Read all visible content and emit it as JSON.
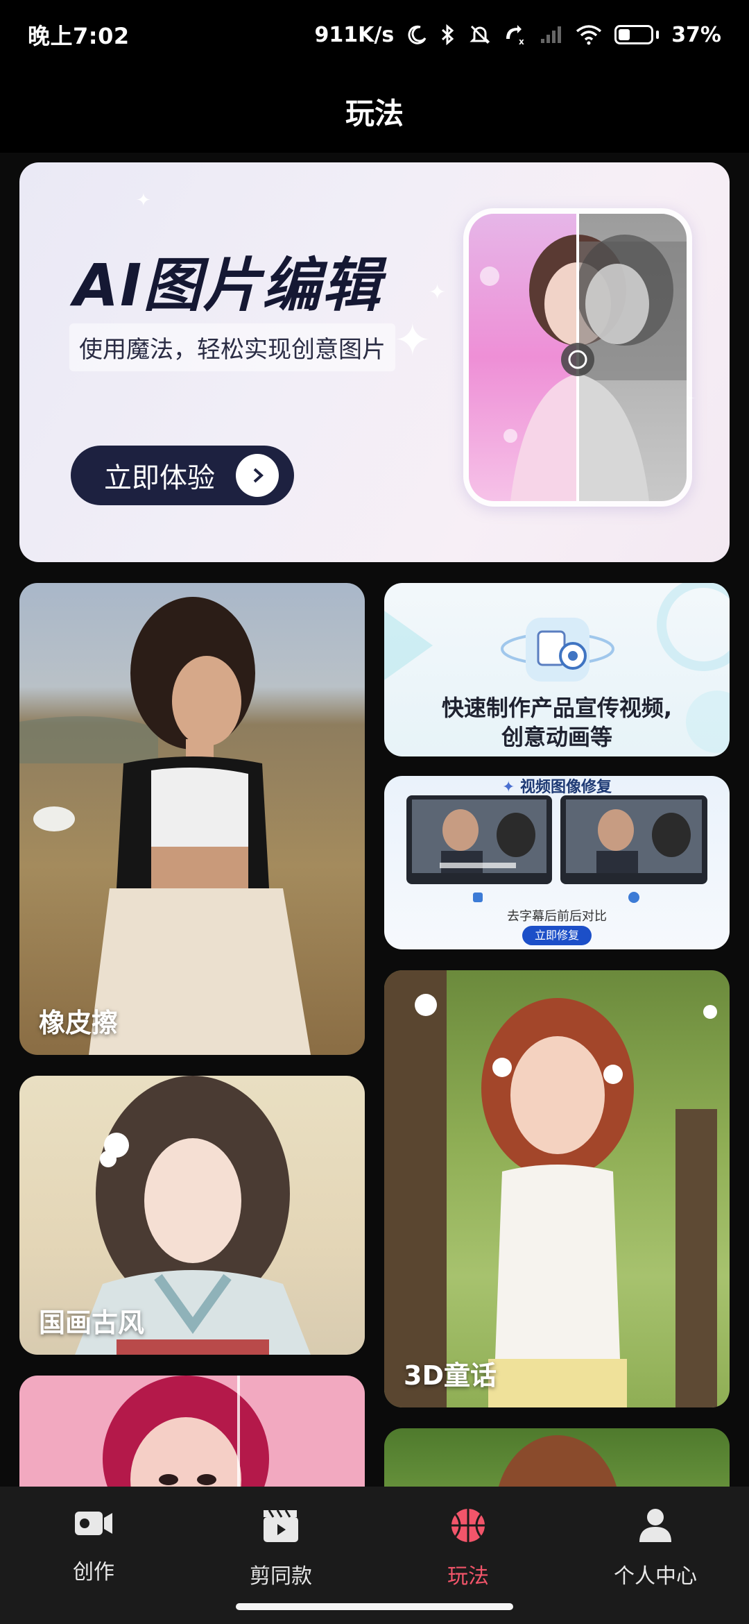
{
  "status": {
    "time": "晚上7:02",
    "speed": "911K/s",
    "battery": "37%",
    "battery_level": 0.37
  },
  "header": {
    "title": "玩法"
  },
  "banner": {
    "title": "AI图片编辑",
    "subtitle": "使用魔法，轻松实现创意图片",
    "button_label": "立即体验"
  },
  "cards": {
    "eraser": {
      "label": "橡皮擦"
    },
    "promo_video": {
      "text_line1": "快速制作产品宣传视频,",
      "text_line2": "创意动画等"
    },
    "video_repair": {
      "header": "视频图像修复",
      "caption": "去字幕后前后对比",
      "button": "立即修复"
    },
    "ink_painting": {
      "label": "国画古风"
    },
    "fairy_3d": {
      "label": "3D童话"
    }
  },
  "nav": {
    "items": [
      {
        "label": "创作",
        "icon": "video-camera-icon"
      },
      {
        "label": "剪同款",
        "icon": "clapperboard-icon"
      },
      {
        "label": "玩法",
        "icon": "basketball-icon"
      },
      {
        "label": "个人中心",
        "icon": "person-icon"
      }
    ],
    "active_index": 2,
    "active_color": "#f2556a"
  }
}
